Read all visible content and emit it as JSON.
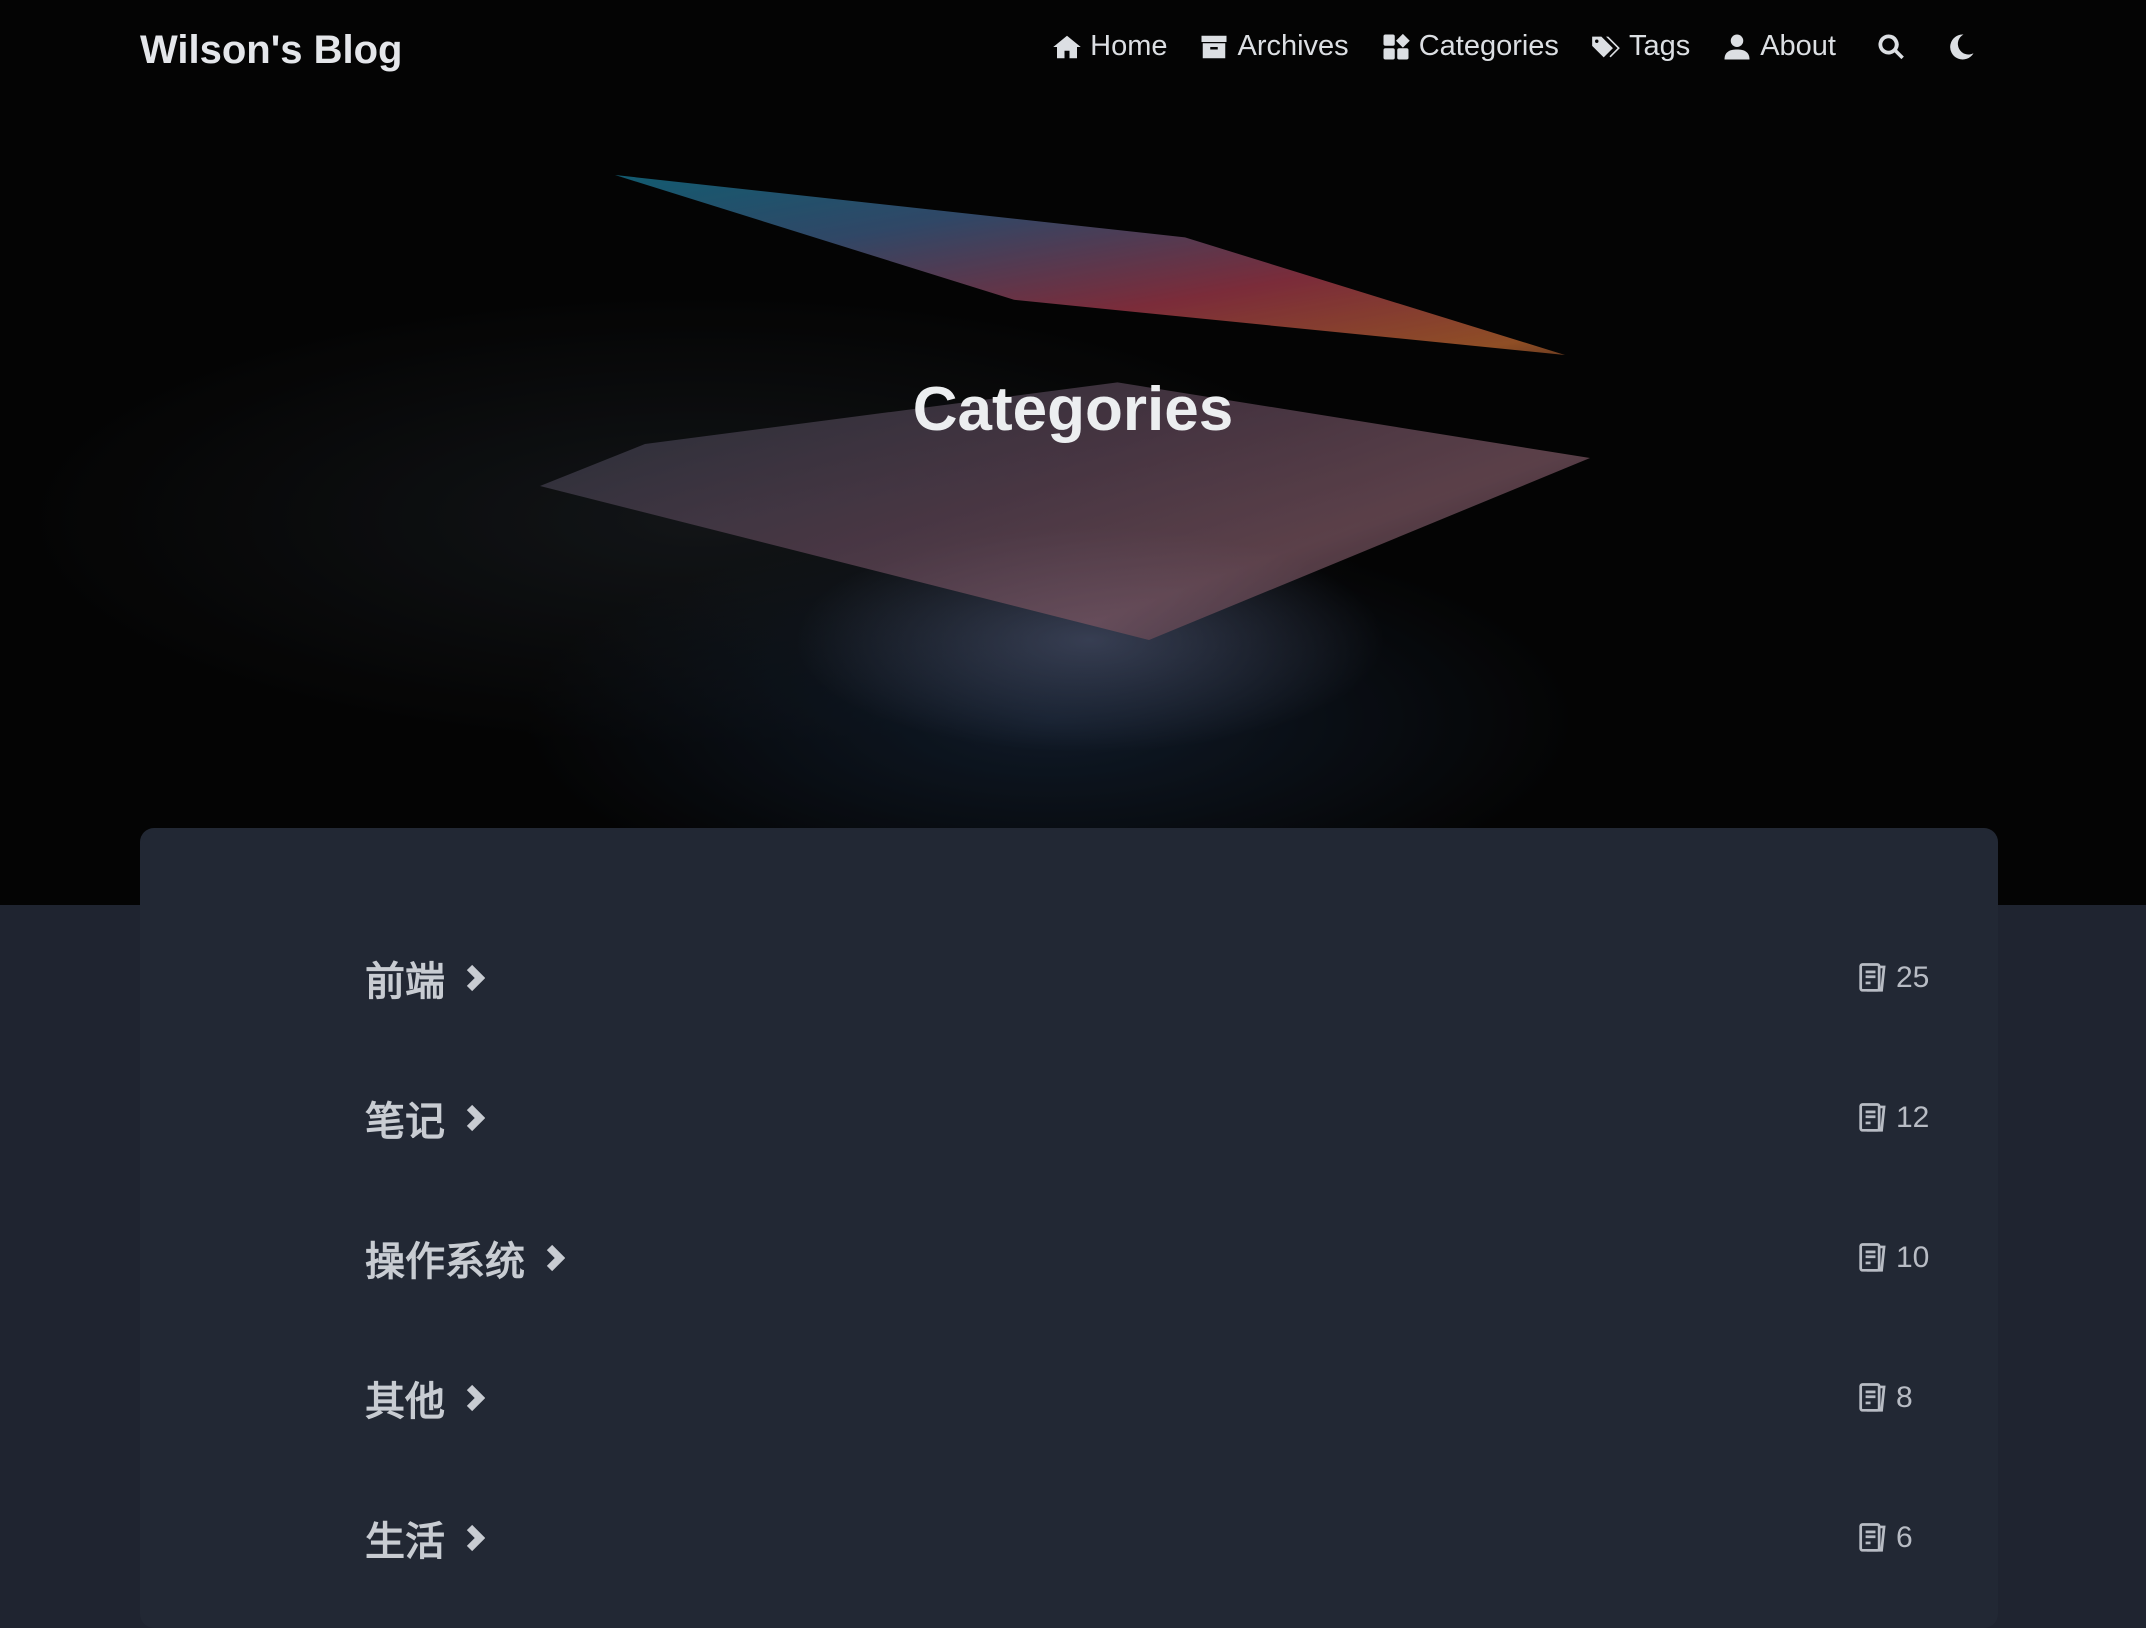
{
  "header": {
    "brand": "Wilson's Blog",
    "nav": [
      {
        "label": "Home",
        "icon": "home-icon"
      },
      {
        "label": "Archives",
        "icon": "archive-icon"
      },
      {
        "label": "Categories",
        "icon": "categories-icon"
      },
      {
        "label": "Tags",
        "icon": "tags-icon"
      },
      {
        "label": "About",
        "icon": "user-icon"
      }
    ]
  },
  "hero": {
    "title": "Categories"
  },
  "categories": [
    {
      "name": "前端",
      "count": "25"
    },
    {
      "name": "笔记",
      "count": "12"
    },
    {
      "name": "操作系统",
      "count": "10"
    },
    {
      "name": "其他",
      "count": "8"
    },
    {
      "name": "生活",
      "count": "6"
    }
  ]
}
